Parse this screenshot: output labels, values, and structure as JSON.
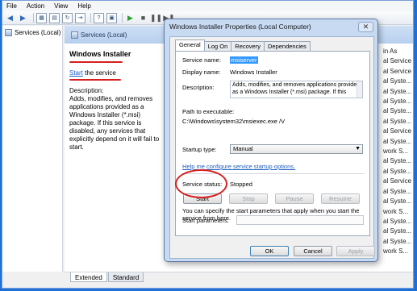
{
  "menu": [
    "File",
    "Action",
    "View",
    "Help"
  ],
  "toolbar_icons": [
    "back-icon",
    "forward-icon",
    "console-tree-icon",
    "properties-icon",
    "refresh-icon",
    "export-icon",
    "help-icon",
    "show-icon",
    "play-icon",
    "stop-icon",
    "pause-icon",
    "restart-icon"
  ],
  "tree": {
    "item_label": "Services (Local)"
  },
  "content": {
    "header_label": "Services (Local)",
    "service_name": "Windows Installer",
    "start_link": "Start",
    "start_suffix": " the service",
    "description_label": "Description:",
    "description": "Adds, modifies, and removes applications provided as a Windows Installer (*.msi) package. If this service is disabled, any services that explicitly depend on it will fail to start."
  },
  "right_column": [
    "in As",
    "al Service",
    "al Service",
    "al Syste...",
    "al Syste...",
    "al Syste...",
    "al Syste...",
    "al Syste...",
    "al Service",
    "al Syste...",
    "work S...",
    "al Syste...",
    "al Syste...",
    "al Service",
    "al Syste...",
    "al Syste...",
    "work S...",
    "al Syste...",
    "al Syste...",
    "al Syste...",
    "work S..."
  ],
  "bottom_tabs": [
    "Extended",
    "Standard"
  ],
  "dialog": {
    "title": "Windows Installer Properties (Local Computer)",
    "close_glyph": "✕",
    "tabs": [
      "General",
      "Log On",
      "Recovery",
      "Dependencies"
    ],
    "service_name_label": "Service name:",
    "service_name_value": "msiserver",
    "display_name_label": "Display name:",
    "display_name_value": "Windows Installer",
    "description_label": "Description:",
    "description_value": "Adds, modifies, and removes applications provided as a Windows Installer (*.msi) package. If this",
    "path_label": "Path to executable:",
    "path_value": "C:\\Windows\\system32\\msiexec.exe /V",
    "startup_type_label": "Startup type:",
    "startup_type_value": "Manual",
    "help_link": "Help me configure service startup options.",
    "status_label": "Service status:",
    "status_value": "Stopped",
    "btn_start": "Start",
    "btn_stop": "Stop",
    "btn_pause": "Pause",
    "btn_resume": "Resume",
    "params_hint": "You can specify the start parameters that apply when you start the service from here.",
    "params_label": "Start parameters:",
    "btn_ok": "OK",
    "btn_cancel": "Cancel",
    "btn_apply": "Apply"
  },
  "colors": {
    "annotation": "#d71e1e",
    "link": "#1c5fc1",
    "selection": "#3399ff"
  }
}
